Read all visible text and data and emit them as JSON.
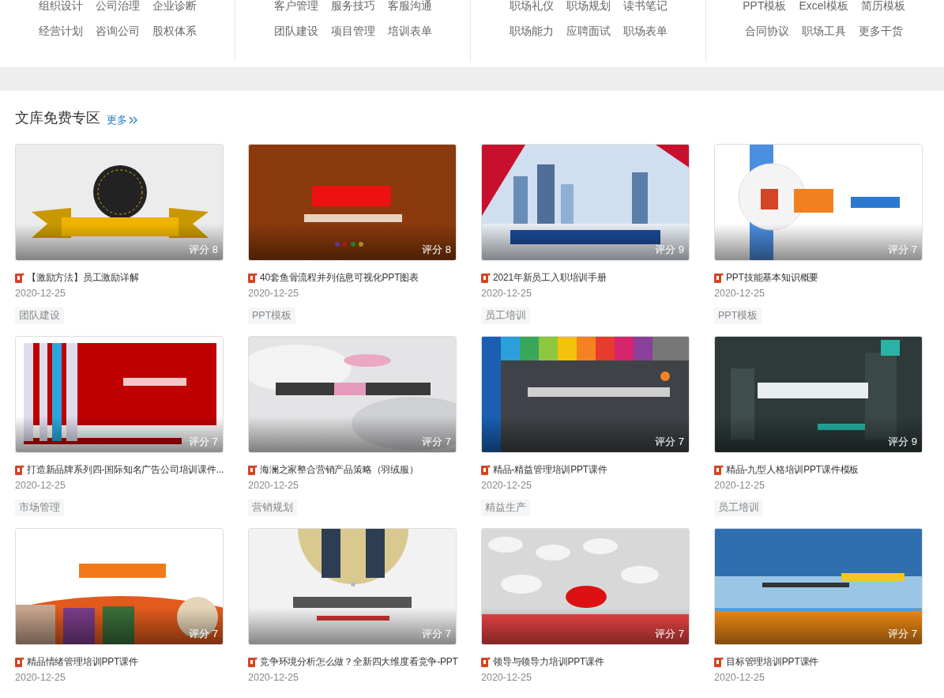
{
  "nav_columns": [
    {
      "rows": [
        [
          "组织设计",
          "公司治理",
          "企业诊断"
        ],
        [
          "经营计划",
          "咨询公司",
          "股权体系"
        ]
      ]
    },
    {
      "rows": [
        [
          "客户管理",
          "服务技巧",
          "客服沟通"
        ],
        [
          "团队建设",
          "项目管理",
          "培训表单"
        ]
      ]
    },
    {
      "rows": [
        [
          "职场礼仪",
          "职场规划",
          "读书笔记"
        ],
        [
          "职场能力",
          "应聘面试",
          "职场表单"
        ]
      ]
    },
    {
      "rows": [
        [
          "PPT模板",
          "Excel模板",
          "简历模板"
        ],
        [
          "合同协议",
          "职场工具",
          "更多干货"
        ]
      ]
    }
  ],
  "section": {
    "title": "文库免费专区",
    "more": "更多"
  },
  "cards": [
    {
      "rating_label": "评分",
      "rating": "8",
      "title": "【激励方法】员工激励详解",
      "date": "2020-12-25",
      "tag": "团队建设"
    },
    {
      "rating_label": "评分",
      "rating": "8",
      "title": "40套鱼骨流程并列信息可视化PPT图表",
      "date": "2020-12-25",
      "tag": "PPT模板"
    },
    {
      "rating_label": "评分",
      "rating": "9",
      "title": "2021年新员工入职培训手册",
      "date": "2020-12-25",
      "tag": "员工培训"
    },
    {
      "rating_label": "评分",
      "rating": "7",
      "title": "PPT技能基本知识概要",
      "date": "2020-12-25",
      "tag": "PPT模板"
    },
    {
      "rating_label": "评分",
      "rating": "7",
      "title": "打造新品牌系列四-国际知名广告公司培训课件...",
      "date": "2020-12-25",
      "tag": "市场管理"
    },
    {
      "rating_label": "评分",
      "rating": "7",
      "title": "海澜之家整合营销产品策略（羽绒服）",
      "date": "2020-12-25",
      "tag": "营销规划"
    },
    {
      "rating_label": "评分",
      "rating": "7",
      "title": "精品-精益管理培训PPT课件",
      "date": "2020-12-25",
      "tag": "精益生产"
    },
    {
      "rating_label": "评分",
      "rating": "9",
      "title": "精品-九型人格培训PPT课件模板",
      "date": "2020-12-25",
      "tag": "员工培训"
    },
    {
      "rating_label": "评分",
      "rating": "7",
      "title": "精品情绪管理培训PPT课件",
      "date": "2020-12-25"
    },
    {
      "rating_label": "评分",
      "rating": "7",
      "title": "竞争环境分析怎么做？全新四大维度看竞争-PPT",
      "date": "2020-12-25"
    },
    {
      "rating_label": "评分",
      "rating": "7",
      "title": "领导与领导力培训PPT课件",
      "date": "2020-12-25"
    },
    {
      "rating_label": "评分",
      "rating": "7",
      "title": "目标管理培训PPT课件",
      "date": "2020-12-25"
    }
  ]
}
